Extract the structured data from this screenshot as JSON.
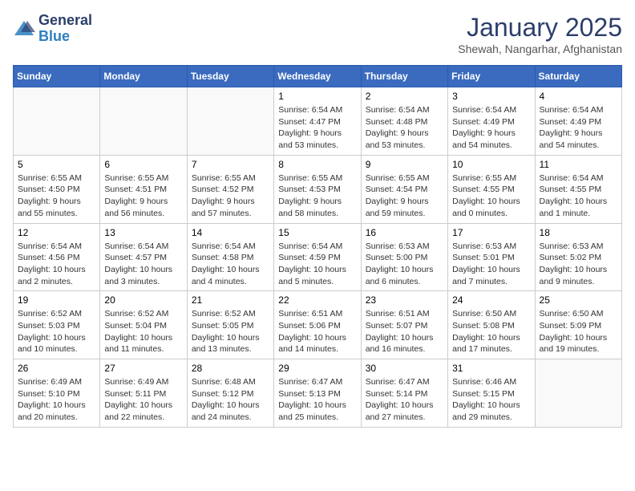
{
  "header": {
    "logo": {
      "general": "General",
      "blue": "Blue"
    },
    "title": "January 2025",
    "subtitle": "Shewah, Nangarhar, Afghanistan"
  },
  "calendar": {
    "days_of_week": [
      "Sunday",
      "Monday",
      "Tuesday",
      "Wednesday",
      "Thursday",
      "Friday",
      "Saturday"
    ],
    "weeks": [
      [
        {
          "day": "",
          "info": ""
        },
        {
          "day": "",
          "info": ""
        },
        {
          "day": "",
          "info": ""
        },
        {
          "day": "1",
          "info": "Sunrise: 6:54 AM\nSunset: 4:47 PM\nDaylight: 9 hours\nand 53 minutes."
        },
        {
          "day": "2",
          "info": "Sunrise: 6:54 AM\nSunset: 4:48 PM\nDaylight: 9 hours\nand 53 minutes."
        },
        {
          "day": "3",
          "info": "Sunrise: 6:54 AM\nSunset: 4:49 PM\nDaylight: 9 hours\nand 54 minutes."
        },
        {
          "day": "4",
          "info": "Sunrise: 6:54 AM\nSunset: 4:49 PM\nDaylight: 9 hours\nand 54 minutes."
        }
      ],
      [
        {
          "day": "5",
          "info": "Sunrise: 6:55 AM\nSunset: 4:50 PM\nDaylight: 9 hours\nand 55 minutes."
        },
        {
          "day": "6",
          "info": "Sunrise: 6:55 AM\nSunset: 4:51 PM\nDaylight: 9 hours\nand 56 minutes."
        },
        {
          "day": "7",
          "info": "Sunrise: 6:55 AM\nSunset: 4:52 PM\nDaylight: 9 hours\nand 57 minutes."
        },
        {
          "day": "8",
          "info": "Sunrise: 6:55 AM\nSunset: 4:53 PM\nDaylight: 9 hours\nand 58 minutes."
        },
        {
          "day": "9",
          "info": "Sunrise: 6:55 AM\nSunset: 4:54 PM\nDaylight: 9 hours\nand 59 minutes."
        },
        {
          "day": "10",
          "info": "Sunrise: 6:55 AM\nSunset: 4:55 PM\nDaylight: 10 hours\nand 0 minutes."
        },
        {
          "day": "11",
          "info": "Sunrise: 6:54 AM\nSunset: 4:55 PM\nDaylight: 10 hours\nand 1 minute."
        }
      ],
      [
        {
          "day": "12",
          "info": "Sunrise: 6:54 AM\nSunset: 4:56 PM\nDaylight: 10 hours\nand 2 minutes."
        },
        {
          "day": "13",
          "info": "Sunrise: 6:54 AM\nSunset: 4:57 PM\nDaylight: 10 hours\nand 3 minutes."
        },
        {
          "day": "14",
          "info": "Sunrise: 6:54 AM\nSunset: 4:58 PM\nDaylight: 10 hours\nand 4 minutes."
        },
        {
          "day": "15",
          "info": "Sunrise: 6:54 AM\nSunset: 4:59 PM\nDaylight: 10 hours\nand 5 minutes."
        },
        {
          "day": "16",
          "info": "Sunrise: 6:53 AM\nSunset: 5:00 PM\nDaylight: 10 hours\nand 6 minutes."
        },
        {
          "day": "17",
          "info": "Sunrise: 6:53 AM\nSunset: 5:01 PM\nDaylight: 10 hours\nand 7 minutes."
        },
        {
          "day": "18",
          "info": "Sunrise: 6:53 AM\nSunset: 5:02 PM\nDaylight: 10 hours\nand 9 minutes."
        }
      ],
      [
        {
          "day": "19",
          "info": "Sunrise: 6:52 AM\nSunset: 5:03 PM\nDaylight: 10 hours\nand 10 minutes."
        },
        {
          "day": "20",
          "info": "Sunrise: 6:52 AM\nSunset: 5:04 PM\nDaylight: 10 hours\nand 11 minutes."
        },
        {
          "day": "21",
          "info": "Sunrise: 6:52 AM\nSunset: 5:05 PM\nDaylight: 10 hours\nand 13 minutes."
        },
        {
          "day": "22",
          "info": "Sunrise: 6:51 AM\nSunset: 5:06 PM\nDaylight: 10 hours\nand 14 minutes."
        },
        {
          "day": "23",
          "info": "Sunrise: 6:51 AM\nSunset: 5:07 PM\nDaylight: 10 hours\nand 16 minutes."
        },
        {
          "day": "24",
          "info": "Sunrise: 6:50 AM\nSunset: 5:08 PM\nDaylight: 10 hours\nand 17 minutes."
        },
        {
          "day": "25",
          "info": "Sunrise: 6:50 AM\nSunset: 5:09 PM\nDaylight: 10 hours\nand 19 minutes."
        }
      ],
      [
        {
          "day": "26",
          "info": "Sunrise: 6:49 AM\nSunset: 5:10 PM\nDaylight: 10 hours\nand 20 minutes."
        },
        {
          "day": "27",
          "info": "Sunrise: 6:49 AM\nSunset: 5:11 PM\nDaylight: 10 hours\nand 22 minutes."
        },
        {
          "day": "28",
          "info": "Sunrise: 6:48 AM\nSunset: 5:12 PM\nDaylight: 10 hours\nand 24 minutes."
        },
        {
          "day": "29",
          "info": "Sunrise: 6:47 AM\nSunset: 5:13 PM\nDaylight: 10 hours\nand 25 minutes."
        },
        {
          "day": "30",
          "info": "Sunrise: 6:47 AM\nSunset: 5:14 PM\nDaylight: 10 hours\nand 27 minutes."
        },
        {
          "day": "31",
          "info": "Sunrise: 6:46 AM\nSunset: 5:15 PM\nDaylight: 10 hours\nand 29 minutes."
        },
        {
          "day": "",
          "info": ""
        }
      ]
    ]
  }
}
